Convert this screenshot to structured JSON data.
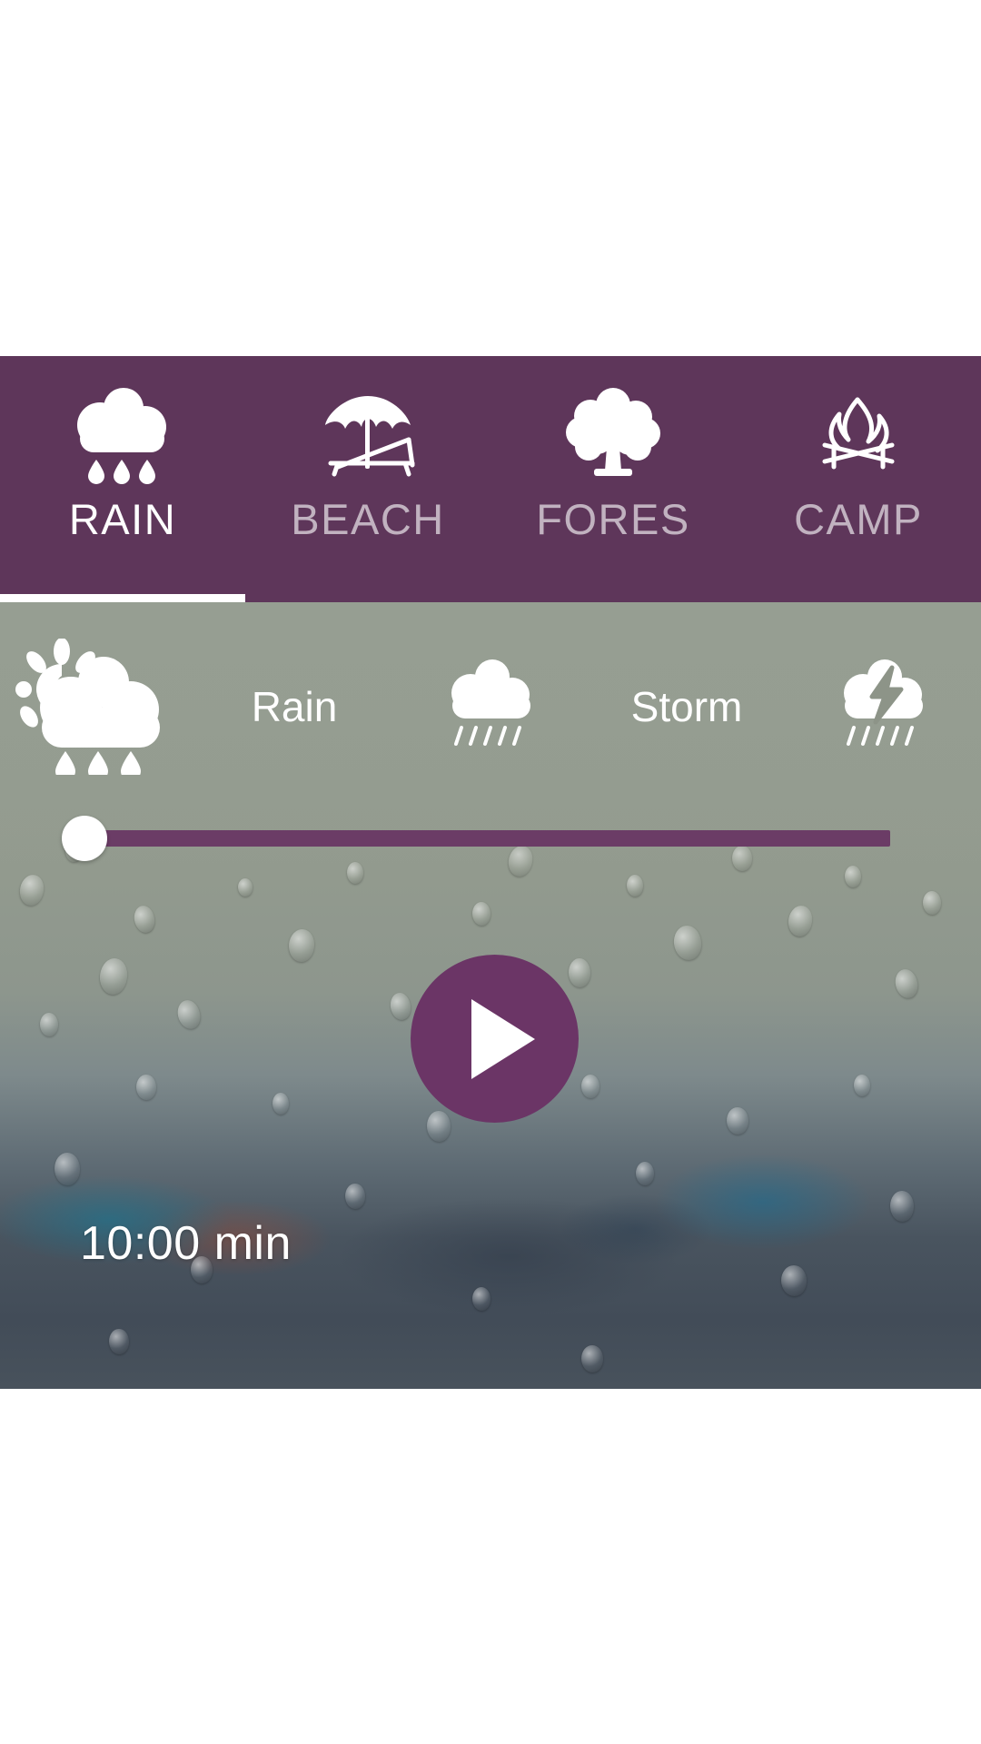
{
  "theme": {
    "accent_purple": "#5e365a",
    "slider_purple": "#6b3c66",
    "play_purple": "#6b3566",
    "active_text": "#ffffff",
    "inactive_text": "rgba(255,255,255,0.62)",
    "overlay_green": "#8d9488"
  },
  "tabs": [
    {
      "label": "RAIN",
      "icon": "rain-cloud-icon",
      "active": true
    },
    {
      "label": "BEACH",
      "icon": "beach-umbrella-icon",
      "active": false
    },
    {
      "label": "FORES",
      "icon": "tree-icon",
      "active": false
    },
    {
      "label": "CAMP",
      "icon": "campfire-icon",
      "active": false
    }
  ],
  "sound_chips": [
    {
      "label": "",
      "icon": "sun-rain-cloud-icon",
      "selected": true
    },
    {
      "label": "Rain",
      "icon": "",
      "selected": false
    },
    {
      "label": "",
      "icon": "rain-cloud-small-icon",
      "selected": false
    },
    {
      "label": "Storm",
      "icon": "",
      "selected": false
    },
    {
      "label": "",
      "icon": "thunderstorm-icon",
      "selected": false
    }
  ],
  "player": {
    "volume_percent": 0,
    "play_icon": "play-triangle-icon",
    "duration_label": "10:00 min"
  }
}
